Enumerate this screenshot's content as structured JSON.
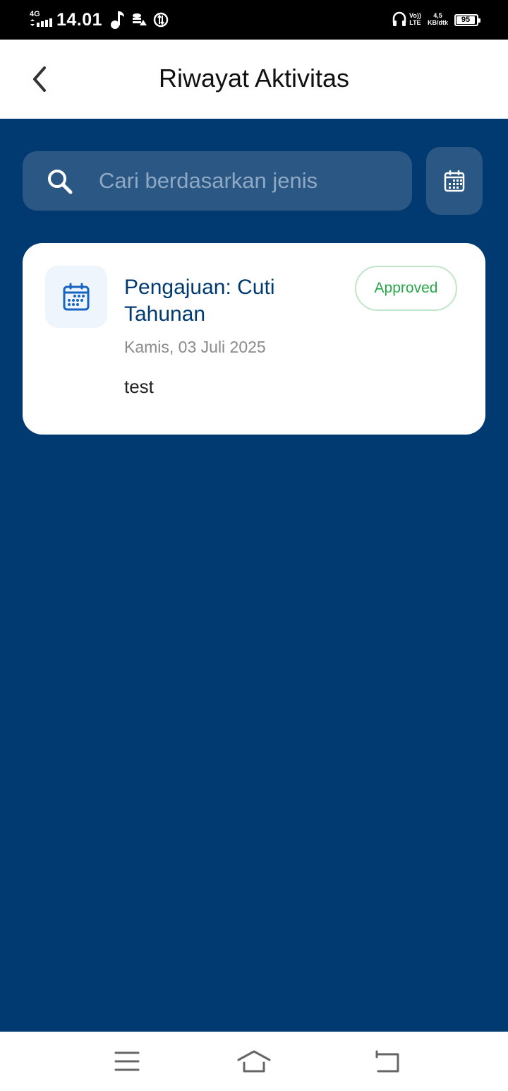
{
  "status_bar": {
    "network": "4G",
    "time": "14.01",
    "volte_line1": "Vo))",
    "volte_line2": "LTE",
    "speed_line1": "4,5",
    "speed_line2": "KB/dtk",
    "battery": "95"
  },
  "header": {
    "title": "Riwayat Aktivitas",
    "back_icon": "chevron-left-icon"
  },
  "search": {
    "placeholder": "Cari berdasarkan jenis",
    "value": ""
  },
  "filter": {
    "icon": "calendar-icon"
  },
  "activities": [
    {
      "icon": "calendar-icon",
      "title": "Pengajuan: Cuti Tahunan",
      "status": "Approved",
      "date": "Kamis, 03 Juli 2025",
      "description": "test"
    }
  ],
  "nav": {
    "menu_icon": "menu-icon",
    "home_icon": "home-icon",
    "back_icon": "back-icon"
  },
  "colors": {
    "primary": "#003a70",
    "search_bg": "#2a5783",
    "approved": "#27a74a",
    "approved_border": "#bfe6c9",
    "icon_blue": "#1565c0"
  }
}
